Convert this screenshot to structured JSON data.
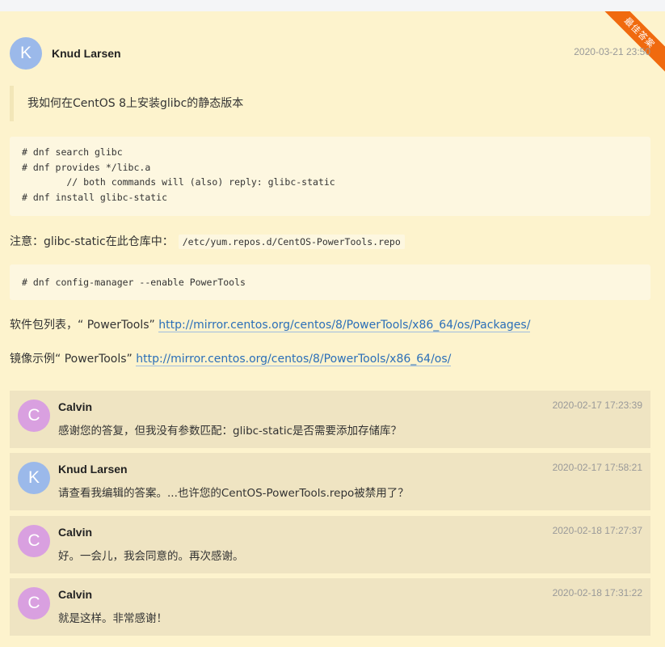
{
  "answer": {
    "badge": "最佳答案",
    "author": {
      "initial": "K",
      "name": "Knud Larsen"
    },
    "date": "2020-03-21 23:50",
    "quote": "我如何在CentOS 8上安装glibc的静态版本",
    "code1": [
      "# dnf search glibc",
      "# dnf provides */libc.a",
      "        // both commands will (also) reply: glibc-static",
      "# dnf install glibc-static"
    ],
    "note_label": "注意：glibc-static在此仓库中：",
    "note_code": "/etc/yum.repos.d/CentOS-PowerTools.repo",
    "code2": [
      "# dnf config-manager --enable PowerTools"
    ],
    "pkg_list_label": "软件包列表，“ PowerTools”",
    "pkg_list_url": "http://mirror.centos.org/centos/8/PowerTools/x86_64/os/Packages/",
    "mirror_label": "镜像示例“ PowerTools”",
    "mirror_url": "http://mirror.centos.org/centos/8/PowerTools/x86_64/os/"
  },
  "comments": [
    {
      "initial": "C",
      "author": "Calvin",
      "date": "2020-02-17 17:23:39",
      "text": "感谢您的答复，但我没有参数匹配：glibc-static是否需要添加存储库？",
      "color": "#d9a0e0"
    },
    {
      "initial": "K",
      "author": "Knud Larsen",
      "date": "2020-02-17 17:58:21",
      "text": "请查看我编辑的答案。...也许您的CentOS-PowerTools.repo被禁用了？",
      "color": "#9bb9ea"
    },
    {
      "initial": "C",
      "author": "Calvin",
      "date": "2020-02-18 17:27:37",
      "text": "好。一会儿，我会同意的。再次感谢。",
      "color": "#d9a0e0"
    },
    {
      "initial": "C",
      "author": "Calvin",
      "date": "2020-02-18 17:31:22",
      "text": "就是这样。非常感谢！",
      "color": "#d9a0e0"
    }
  ]
}
